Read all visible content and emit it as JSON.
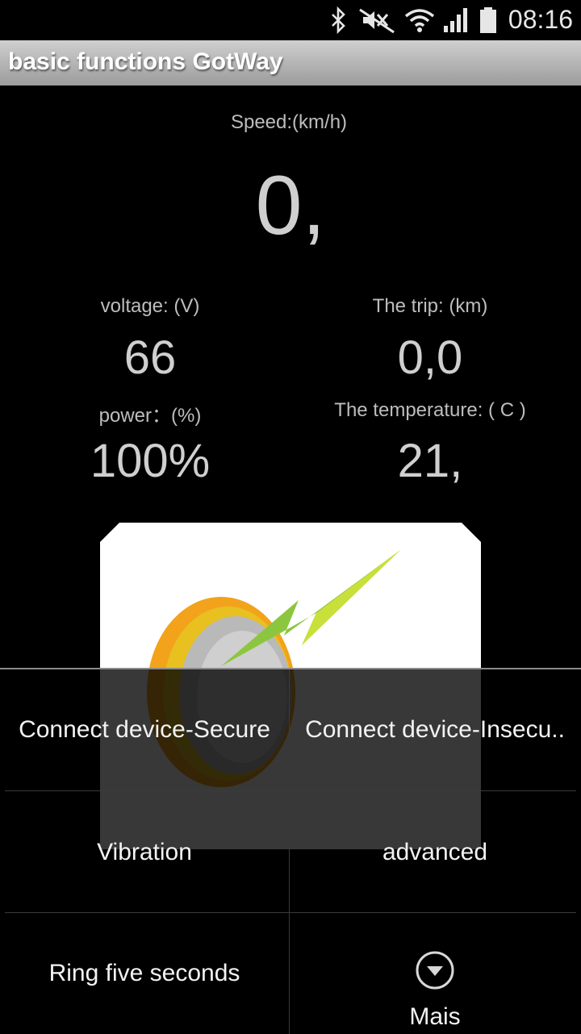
{
  "status_bar": {
    "time": "08:16",
    "icons": [
      "bluetooth-icon",
      "mute-icon",
      "wifi-icon",
      "signal-icon",
      "battery-icon"
    ]
  },
  "app": {
    "title": "basic functions GotWay"
  },
  "speed": {
    "label": "Speed:(km/h)",
    "value": "0,"
  },
  "voltage": {
    "label": "voltage: (V)",
    "value": "66"
  },
  "trip": {
    "label": "The trip: (km)",
    "value": "0,0"
  },
  "power": {
    "label": "power：(%)",
    "value": "100%"
  },
  "temperature": {
    "label": "The temperature: ( C )",
    "value": "21,"
  },
  "menu": {
    "connect_secure": "Connect device-Secure",
    "connect_insecure": "Connect device-Insecu..",
    "vibration": "Vibration",
    "advanced": "advanced",
    "ring": "Ring five seconds",
    "more": "Mais"
  },
  "colors": {
    "background": "#000000",
    "titlebar": "#b5b5b5",
    "logo_orange": "#f2a31b",
    "logo_green": "#8cc63f"
  }
}
